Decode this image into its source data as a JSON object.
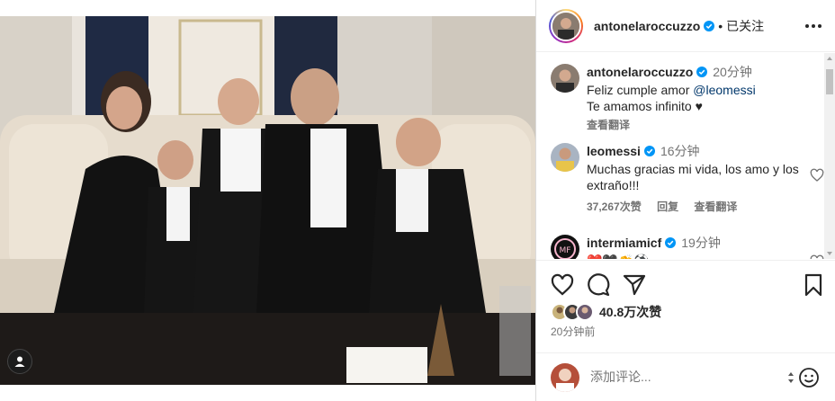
{
  "post": {
    "author": "antonelaroccuzzo",
    "follow_state": "已关注",
    "dot": "•",
    "likes": "40.8万次赞",
    "time_ago": "20分钟前",
    "add_comment_placeholder": "添加评论..."
  },
  "comments": [
    {
      "username": "antonelaroccuzzo",
      "time": "20分钟",
      "text_before_mention": "Feliz cumple amor ",
      "mention": "@leomessi",
      "text_line2": "Te amamos infinito ♥",
      "translate": "查看翻译"
    },
    {
      "username": "leomessi",
      "time": "16分钟",
      "text": "Muchas gracias mi vida, los amo y los extraño!!!",
      "likes": "37,267次赞",
      "reply": "回复",
      "translate": "查看翻译"
    },
    {
      "username": "intermiamicf",
      "time": "19分钟",
      "text": "❤️🖤👏⚽"
    }
  ],
  "icons": {
    "verified": "verified-badge-icon",
    "like": "heart-icon",
    "comment": "comment-bubble-icon",
    "share": "paper-plane-icon",
    "save": "bookmark-icon",
    "more": "more-horizontal-icon",
    "emoji": "smiley-icon",
    "user_tag": "user-tag-icon"
  },
  "colors": {
    "verified": "#0095f6",
    "mention": "#00376b",
    "secondary_text": "#737373"
  }
}
